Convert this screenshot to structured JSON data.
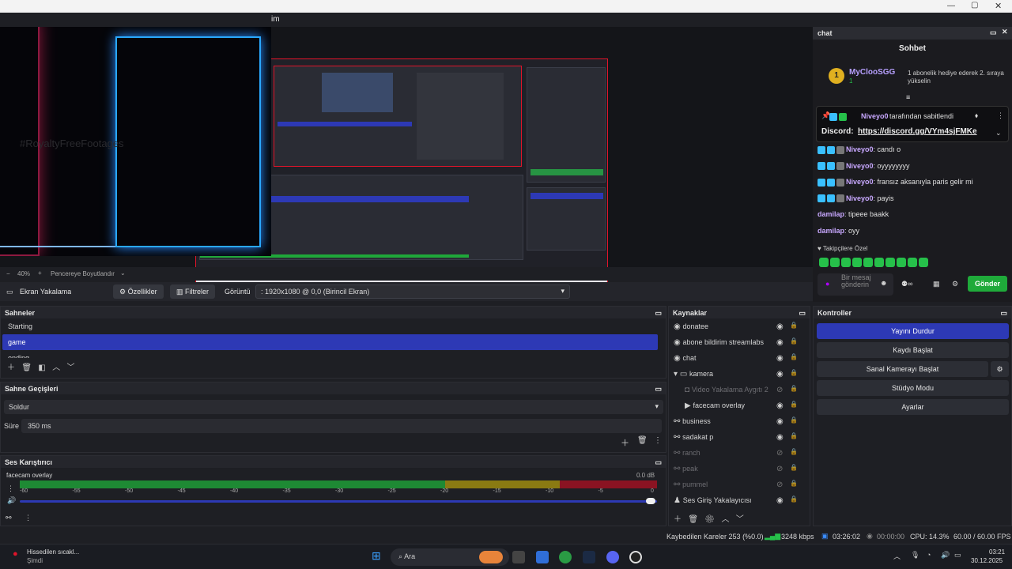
{
  "window": {
    "title_fragment": "im"
  },
  "preview": {
    "watermark": "#RoyaltyFreeFootages",
    "zoom": "40%",
    "fit_mode": "Pencereye Boyutlandır"
  },
  "props_bar": {
    "source_name": "Ekran Yakalama",
    "properties_label": "Özellikler",
    "filters_label": "Filtreler",
    "display_label": "Görüntü",
    "display_value": ": 1920x1080 @ 0,0 (Birincil Ekran)"
  },
  "scenes": {
    "title": "Sahneler",
    "items": [
      "Starting",
      "game",
      "ending"
    ],
    "selected": "game"
  },
  "transitions": {
    "title": "Sahne Geçişleri",
    "selected": "Soldur",
    "duration_label": "Süre",
    "duration_value": "350 ms"
  },
  "mixer": {
    "title": "Ses Karıştırıcı",
    "channel": "facecam overlay",
    "level": "0.0 dB",
    "ticks": [
      "-60",
      "-55",
      "-50",
      "-45",
      "-40",
      "-35",
      "-30",
      "-25",
      "-20",
      "-15",
      "-10",
      "-5",
      "0"
    ],
    "volume": 1.0
  },
  "sources": {
    "title": "Kaynaklar",
    "items": [
      {
        "name": "donatee",
        "visible": true,
        "indent": 0,
        "icon": "browser-icon"
      },
      {
        "name": "abone bildirim streamlabs",
        "visible": true,
        "indent": 0,
        "icon": "browser-icon"
      },
      {
        "name": "chat",
        "visible": true,
        "indent": 0,
        "icon": "browser-icon"
      },
      {
        "name": "kamera",
        "visible": true,
        "indent": 0,
        "icon": "folder-icon"
      },
      {
        "name": "Video Yakalama Aygıtı 2",
        "visible": false,
        "indent": 1,
        "icon": "camera-icon"
      },
      {
        "name": "facecam overlay",
        "visible": true,
        "indent": 1,
        "icon": "play-icon"
      },
      {
        "name": "business",
        "visible": true,
        "indent": 0,
        "icon": "link-icon"
      },
      {
        "name": "sadakat p",
        "visible": true,
        "indent": 0,
        "icon": "link-icon"
      },
      {
        "name": "ranch",
        "visible": false,
        "indent": 0,
        "icon": "link-icon"
      },
      {
        "name": "peak",
        "visible": false,
        "indent": 0,
        "icon": "link-icon"
      },
      {
        "name": "pummel",
        "visible": false,
        "indent": 0,
        "icon": "link-icon"
      },
      {
        "name": "Ses Giriş Yakalayıcısı",
        "visible": true,
        "indent": 0,
        "icon": "mic-icon"
      }
    ]
  },
  "controls": {
    "title": "Kontroller",
    "stop_stream": "Yayını Durdur",
    "start_record": "Kaydı Başlat",
    "virtual_cam": "Sanal Kamerayı Başlat",
    "studio_mode": "Stüdyo Modu",
    "settings": "Ayarlar"
  },
  "chat": {
    "dock_title": "chat",
    "header": "Sohbet",
    "gift": {
      "rank": "1",
      "user": "MyClooSGG",
      "count": "1",
      "text": "1 abonelik hediye ederek 2. sıraya yükselin"
    },
    "pinned": {
      "by_user": "Niveyo0",
      "by_text": "tarafından sabitlendi",
      "label": "Discord:",
      "link": "https://discord.gg/VYm4sjFMKe"
    },
    "messages": [
      {
        "user": "Niveyo0",
        "text": "candı o",
        "badges": true
      },
      {
        "user": "Niveyo0",
        "text": "oyyyyyyyy",
        "badges": true
      },
      {
        "user": "Niveyo0",
        "text": "fransız aksanıyla paris gelir mi",
        "badges": true
      },
      {
        "user": "Niveyo0",
        "text": "payis",
        "badges": true
      },
      {
        "user": "damilap",
        "text": "tipeee baakk",
        "badges": false
      },
      {
        "user": "damilap",
        "text": "oyy",
        "badges": false
      }
    ],
    "followers_label": "Takipçilere Özel",
    "input_placeholder": "Bir mesaj gönderin",
    "send_label": "Gönder"
  },
  "status": {
    "dropped": "Kaybedilen Kareler 253 (%0.0)",
    "bitrate": "3248 kbps",
    "stream_time": "03:26:02",
    "rec_time": "00:00:00",
    "cpu": "CPU: 14.3%",
    "fps": "60.00 / 60.00 FPS"
  },
  "taskbar": {
    "notif_title": "Hissedilen sıcakl...",
    "notif_sub": "Şimdi",
    "search": "Ara",
    "time": "03:21",
    "date": "30.12.2025"
  },
  "colors": {
    "accent": "#2d39b5",
    "live_red": "#e0142a",
    "chat_green": "#26c04a"
  }
}
